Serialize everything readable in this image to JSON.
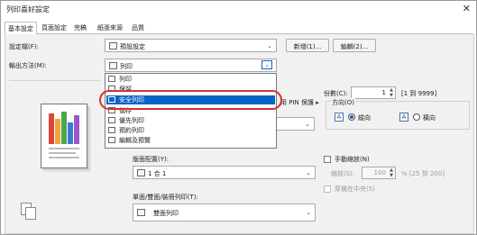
{
  "window": {
    "title": "列印喜好設定",
    "close_glyph": "✕"
  },
  "tabs": [
    {
      "label": "基本設定"
    },
    {
      "label": "頁面設定"
    },
    {
      "label": "完稿"
    },
    {
      "label": "紙張來源"
    },
    {
      "label": "品質"
    }
  ],
  "profile": {
    "label": "設定檔(F):",
    "value": "預設設定",
    "add_button": "新增(1)...",
    "edit_button": "編輯(2)..."
  },
  "output_method": {
    "label": "輸出方法(M):",
    "value": "列印",
    "options": [
      "列印",
      "保留",
      "安全列印",
      "儲存",
      "優先列印",
      "預約列印",
      "編輯及預覽"
    ],
    "selected_index": 2
  },
  "pin_hint": "用 PIN 保護 ▸",
  "copies": {
    "label": "份數(C):",
    "value": "1",
    "range": "[1 到 9999]"
  },
  "orientation": {
    "label": "方向(O)",
    "portrait": "縱向",
    "landscape": "橫向",
    "selected": "portrait"
  },
  "page_layout": {
    "label": "版面配置(Y):",
    "value": "1 合 1"
  },
  "manual_scaling": {
    "label": "手動縮放(N)",
    "checked": false
  },
  "scaling": {
    "label": "縮放(S):",
    "value": "100",
    "range": "% [25 到 200]"
  },
  "center": {
    "label": "厚機在中央(5)"
  },
  "duplex": {
    "label": "單面/雙面/裝冊列印(T):",
    "value": "雙面列印"
  },
  "colors": {
    "accent": "#0a64c8",
    "highlight_ring": "#d93030"
  }
}
